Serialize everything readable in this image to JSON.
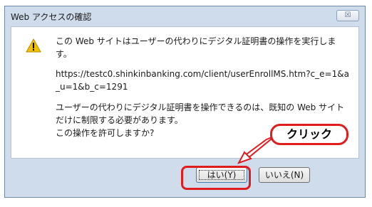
{
  "dialog": {
    "title": "Web アクセスの確認",
    "close_glyph": "☒",
    "icon": "warning-icon",
    "message_1": "この Web サイトはユーザーの代わりにデジタル証明書の操作を実行します。",
    "url": "https://testc0.shinkinbanking.com/client/userEnrollMS.htm?c_e=1&a_u=1&b_c=1291",
    "message_2": "ユーザーの代わりにデジタル証明書を操作できるのは、既知の Web サイトだけに制限する必要があります。\nこの操作を許可しますか?",
    "buttons": {
      "yes_label": "はい(Y)",
      "no_label": "いいえ(N)"
    }
  },
  "annotation": {
    "callout_text": "クリック",
    "highlight_color": "#e11c1c"
  }
}
